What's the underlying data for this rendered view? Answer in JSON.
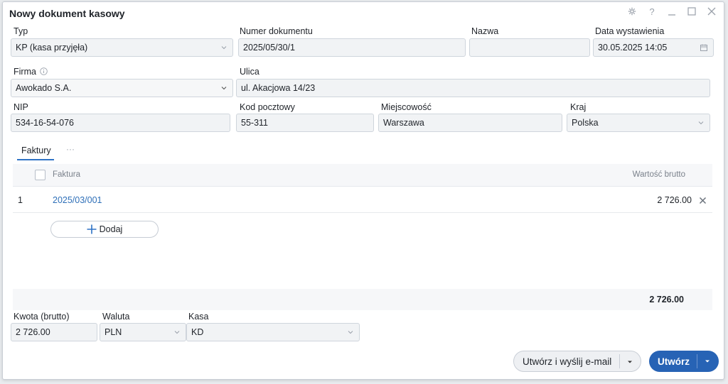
{
  "window": {
    "title": "Nowy dokument kasowy"
  },
  "fields": {
    "typ": {
      "label": "Typ",
      "value": "KP (kasa przyjęła)"
    },
    "numer": {
      "label": "Numer dokumentu",
      "value": "2025/05/30/1"
    },
    "nazwa": {
      "label": "Nazwa",
      "value": ""
    },
    "data": {
      "label": "Data wystawienia",
      "value": "30.05.2025 14:05"
    },
    "firma": {
      "label": "Firma",
      "value": "Awokado S.A."
    },
    "ulica": {
      "label": "Ulica",
      "value": "ul. Akacjowa 14/23"
    },
    "nip": {
      "label": "NIP",
      "value": "534-16-54-076"
    },
    "kod": {
      "label": "Kod pocztowy",
      "value": "55-311"
    },
    "miejscowosc": {
      "label": "Miejscowość",
      "value": "Warszawa"
    },
    "kraj": {
      "label": "Kraj",
      "value": "Polska"
    },
    "kwota": {
      "label": "Kwota (brutto)",
      "value": "2 726.00"
    },
    "waluta": {
      "label": "Waluta",
      "value": "PLN"
    },
    "kasa": {
      "label": "Kasa",
      "value": "KD"
    }
  },
  "tabs": {
    "active": "Faktury",
    "more": "···"
  },
  "table": {
    "columns": {
      "faktura": "Faktura",
      "wartosc": "Wartość brutto"
    },
    "rows": [
      {
        "index": "1",
        "faktura": "2025/03/001",
        "wartosc": "2 726.00"
      }
    ],
    "add_label": "Dodaj",
    "total": "2 726.00"
  },
  "buttons": {
    "create_send": "Utwórz i wyślij e-mail",
    "create": "Utwórz"
  },
  "colors": {
    "accent": "#2763b5",
    "link": "#2e6fb8"
  }
}
